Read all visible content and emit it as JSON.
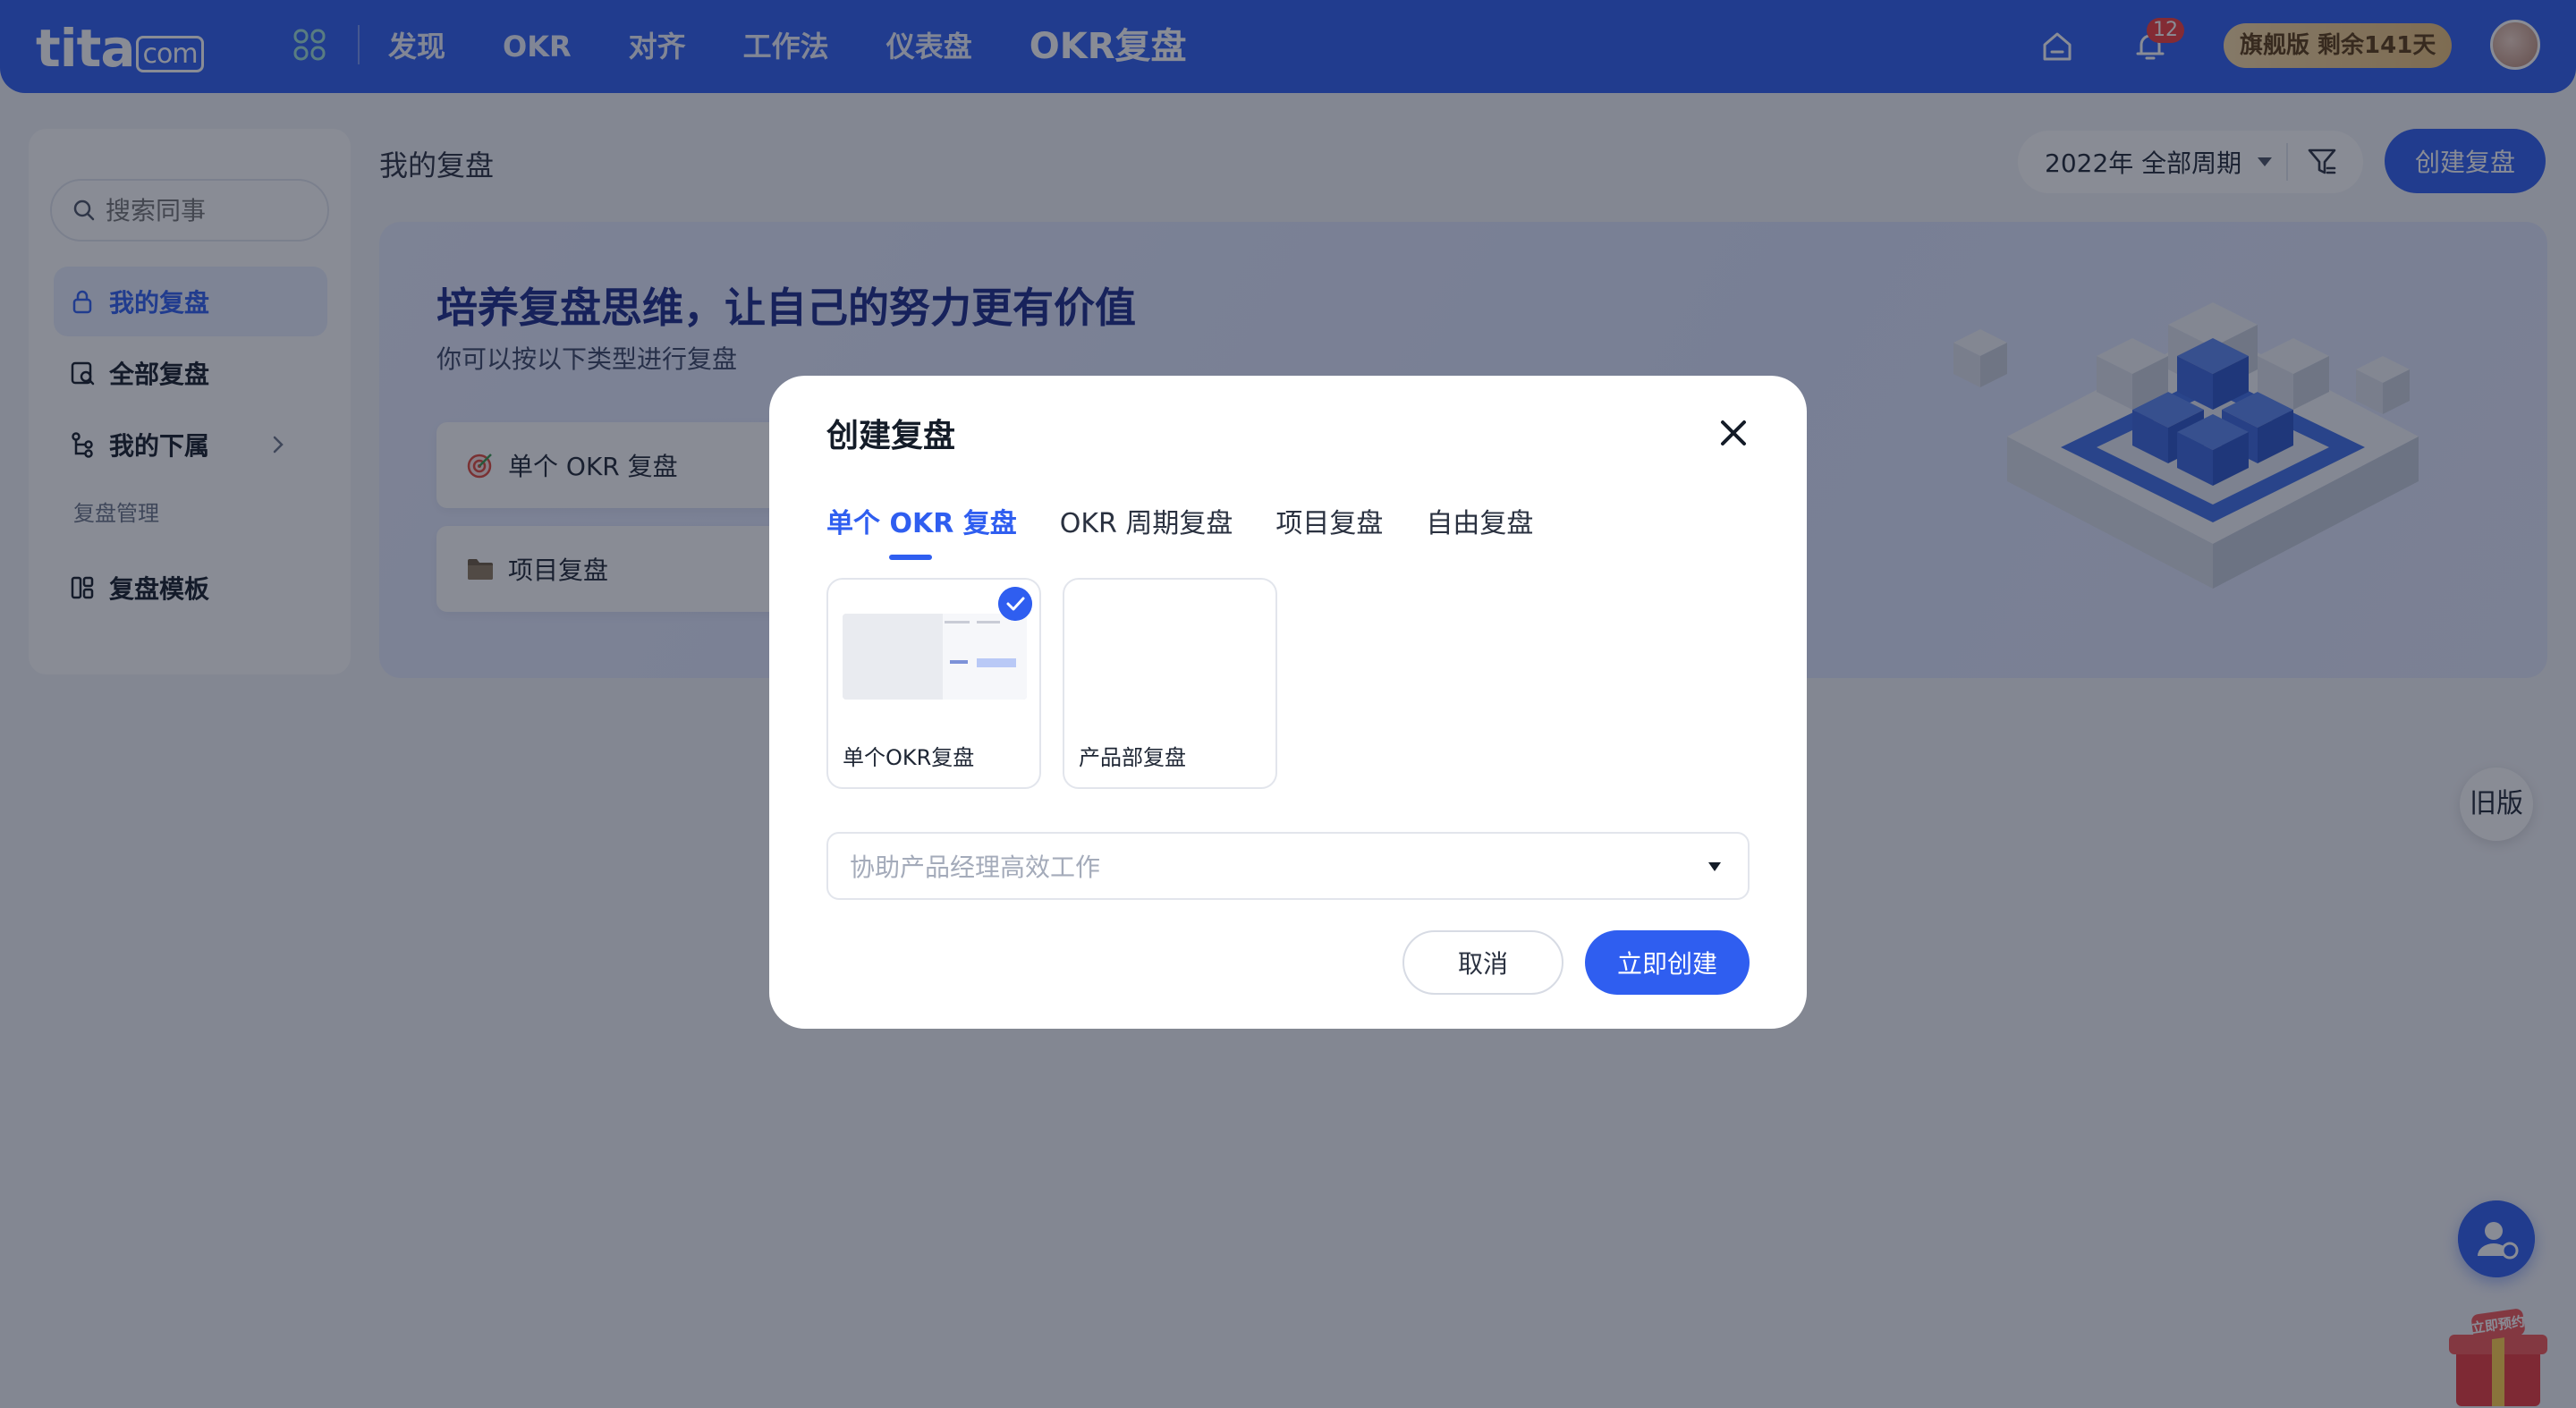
{
  "brand": {
    "logo_main": "tita",
    "logo_domain": "com"
  },
  "nav": {
    "items": [
      "发现",
      "OKR",
      "对齐",
      "工作法",
      "仪表盘"
    ],
    "active": "OKR复盘"
  },
  "header": {
    "notifications": "12",
    "plan_badge": "旗舰版 剩余141天"
  },
  "sidebar": {
    "search_placeholder": "搜索同事",
    "items": [
      {
        "label": "我的复盘",
        "icon": "lock-icon",
        "active": true
      },
      {
        "label": "全部复盘",
        "icon": "review-search-icon"
      },
      {
        "label": "我的下属",
        "icon": "org-tree-icon"
      }
    ],
    "section_label": "复盘管理",
    "template_item": {
      "label": "复盘模板",
      "icon": "template-icon"
    }
  },
  "page": {
    "title": "我的复盘",
    "period_select": "2022年 全部周期",
    "create_button": "创建复盘"
  },
  "banner": {
    "title": "培养复盘思维，让自己的努力更有价值",
    "subtitle": "你可以按以下类型进行复盘",
    "cards": [
      {
        "label": "单个 OKR 复盘",
        "icon": "target-icon"
      },
      {
        "label": "项目复盘",
        "icon": "folder-icon"
      }
    ]
  },
  "floating": {
    "old_version": "旧版",
    "gift_text": "立即预约"
  },
  "modal": {
    "title": "创建复盘",
    "tabs": [
      "单个 OKR 复盘",
      "OKR 周期复盘",
      "项目复盘",
      "自由复盘"
    ],
    "active_tab": 0,
    "templates": [
      {
        "label": "单个OKR复盘",
        "selected": true
      },
      {
        "label": "产品部复盘",
        "selected": false
      }
    ],
    "dropdown_placeholder": "协助产品经理高效工作",
    "cancel": "取消",
    "confirm": "立即创建"
  },
  "colors": {
    "primary": "#2f5ef0",
    "overlay": "rgba(20,26,44,0.5)",
    "banner_title": "#1b2a8a"
  }
}
